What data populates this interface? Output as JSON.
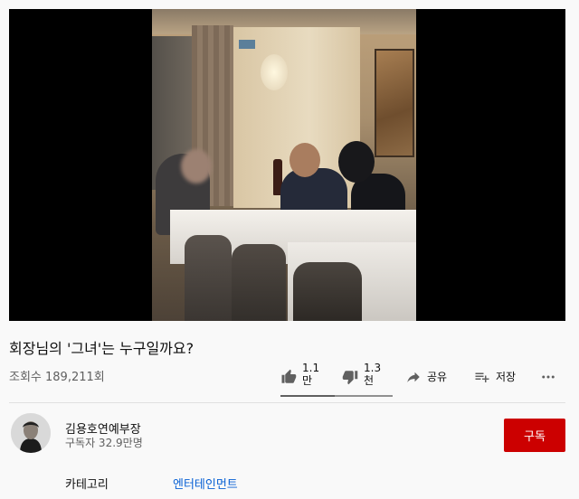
{
  "video": {
    "title": "회장님의 '그녀'는 누구일까요?",
    "views": "조회수 189,211회"
  },
  "actions": {
    "like": {
      "count_line1": "1.1",
      "count_line2": "만",
      "icon": "thumbs-up-icon"
    },
    "dislike": {
      "count_line1": "1.3",
      "count_line2": "천",
      "icon": "thumbs-down-icon"
    },
    "share": {
      "label": "공유",
      "icon": "share-icon"
    },
    "save": {
      "label": "저장",
      "icon": "playlist-add-icon"
    },
    "more": {
      "icon": "more-horizontal-icon"
    }
  },
  "channel": {
    "name": "김용호연예부장",
    "subscribers": "구독자 32.9만명",
    "subscribe_label": "구독"
  },
  "category": {
    "label": "카테고리",
    "value": "엔터테인먼트"
  },
  "colors": {
    "subscribe": "#cc0000",
    "link": "#065fd4",
    "secondary_text": "#606060"
  }
}
